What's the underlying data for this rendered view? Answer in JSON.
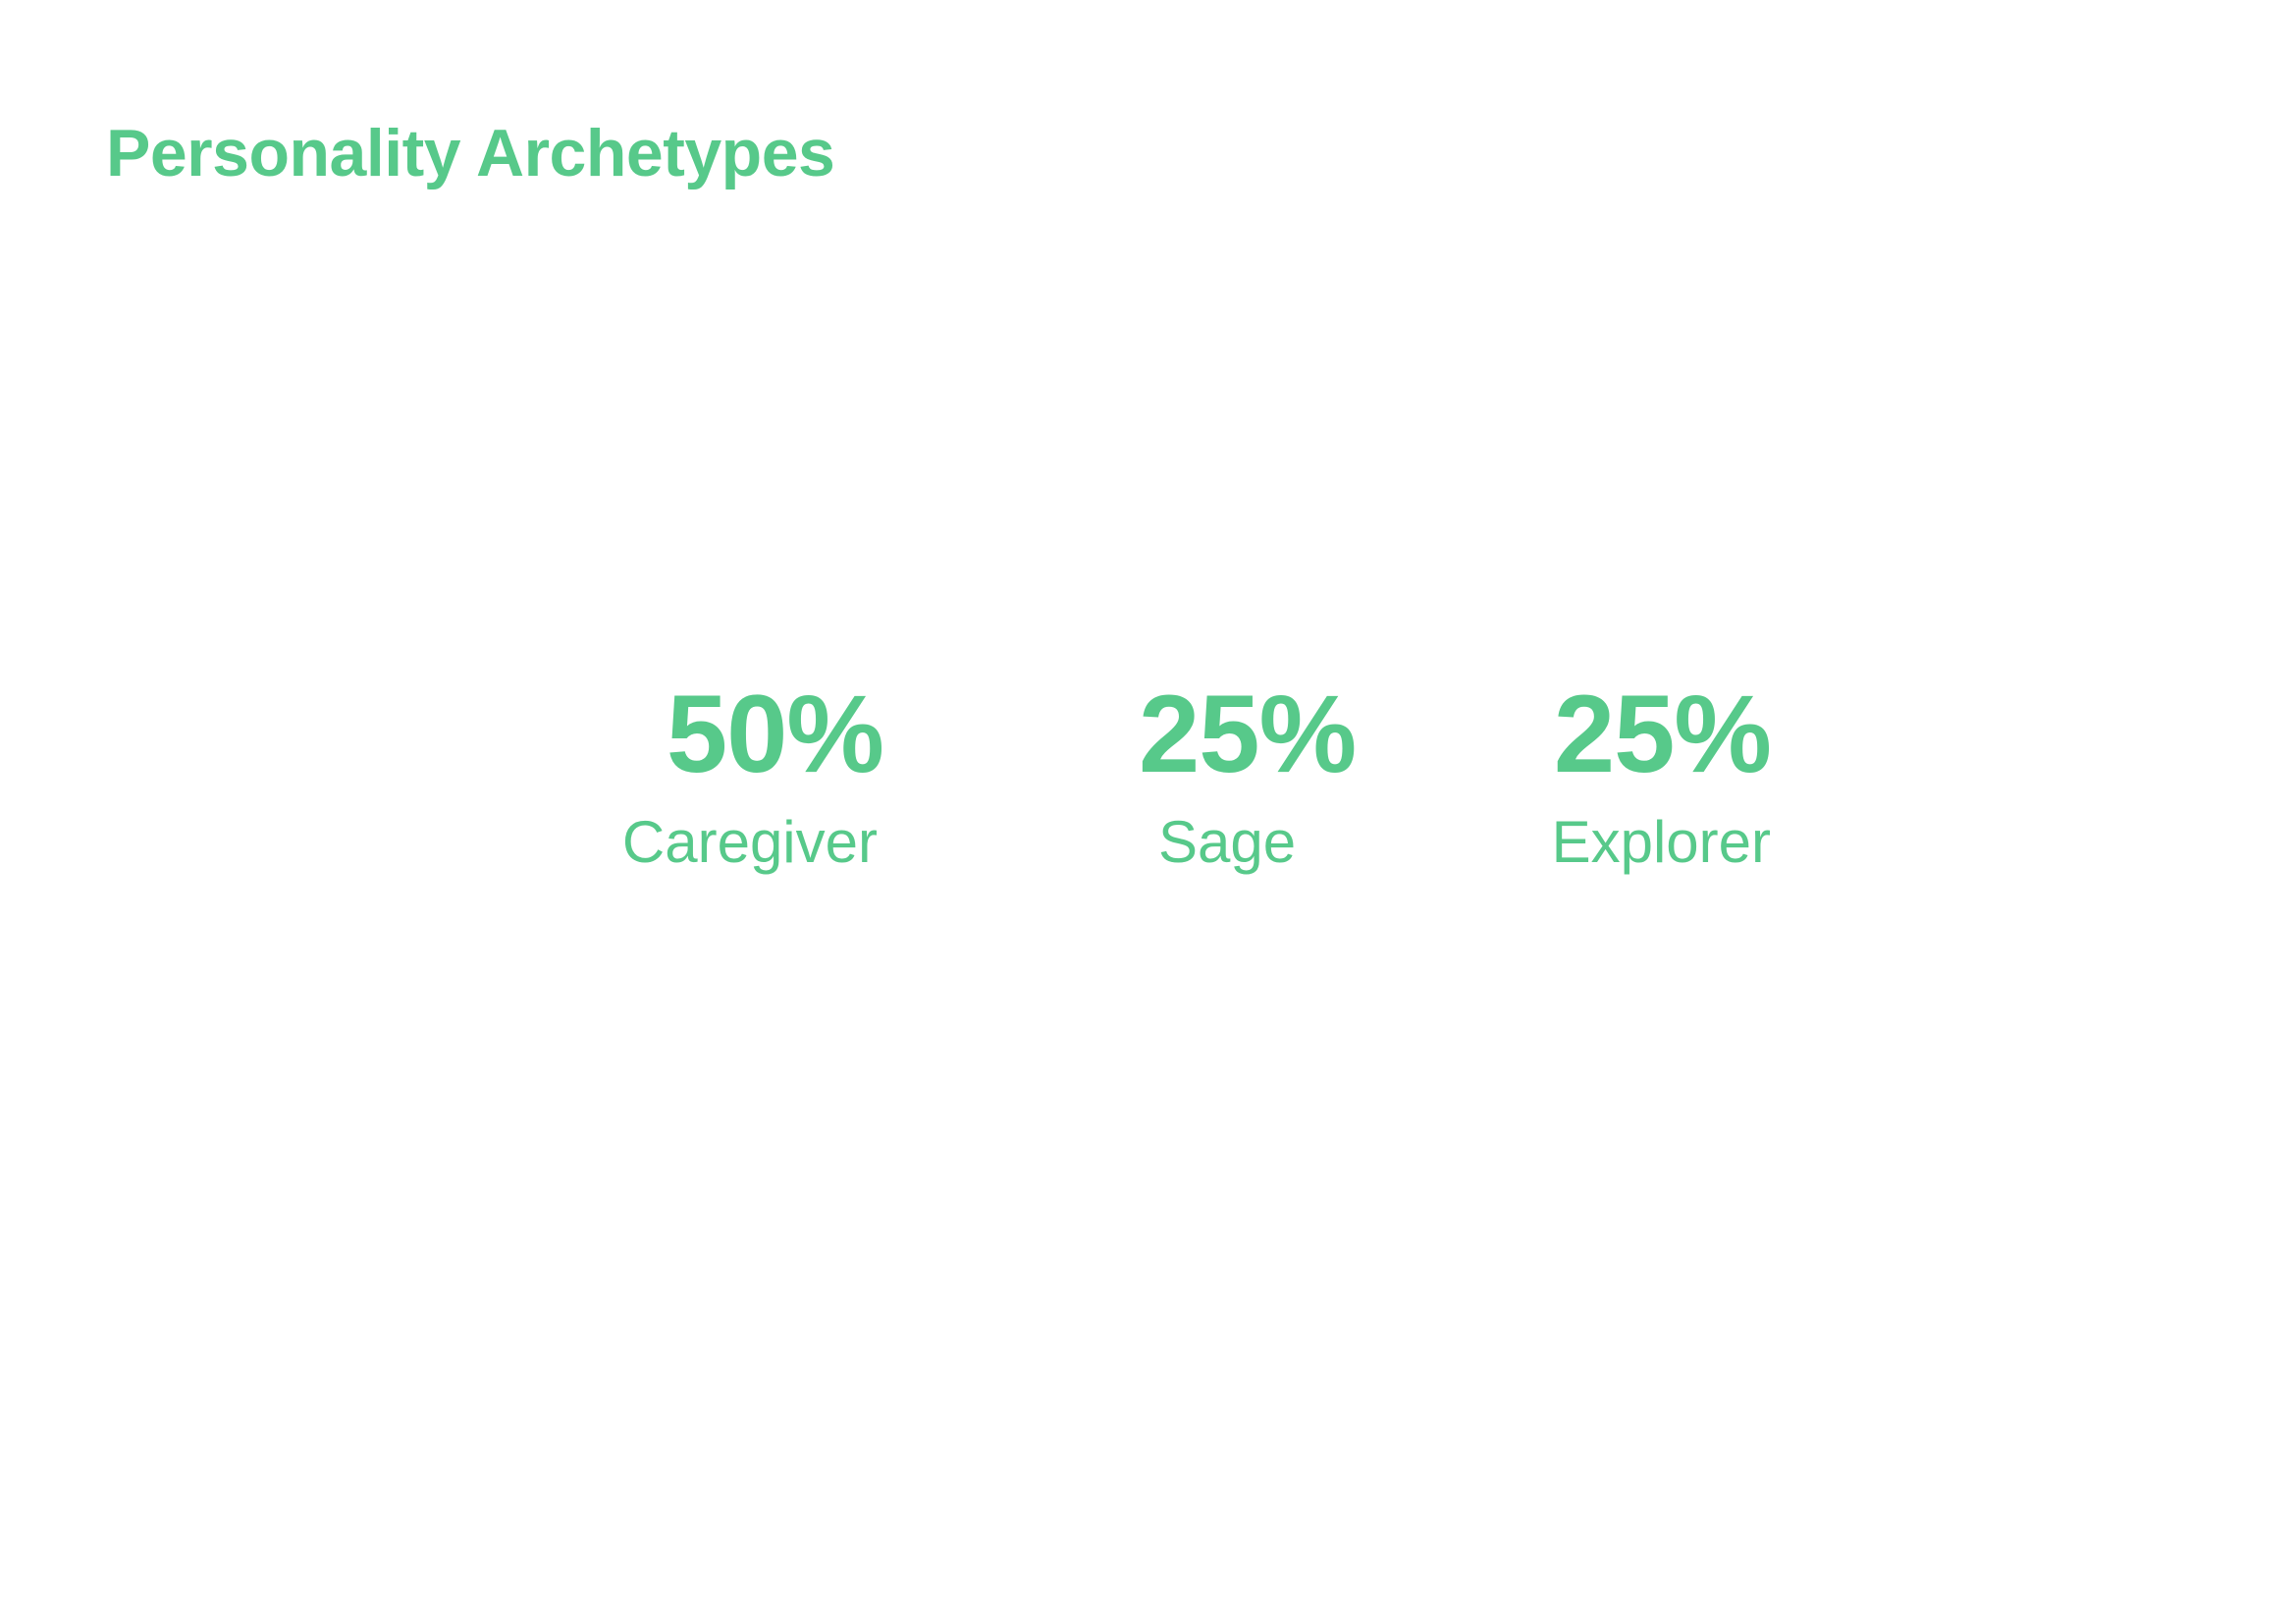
{
  "page": {
    "title": "Personality Archetypes",
    "accent_color": "#57c98a"
  },
  "stats": [
    {
      "value": "50%",
      "label": "Caregiver"
    },
    {
      "value": "25%",
      "label": "Sage"
    },
    {
      "value": "25%",
      "label": "Explorer"
    }
  ]
}
